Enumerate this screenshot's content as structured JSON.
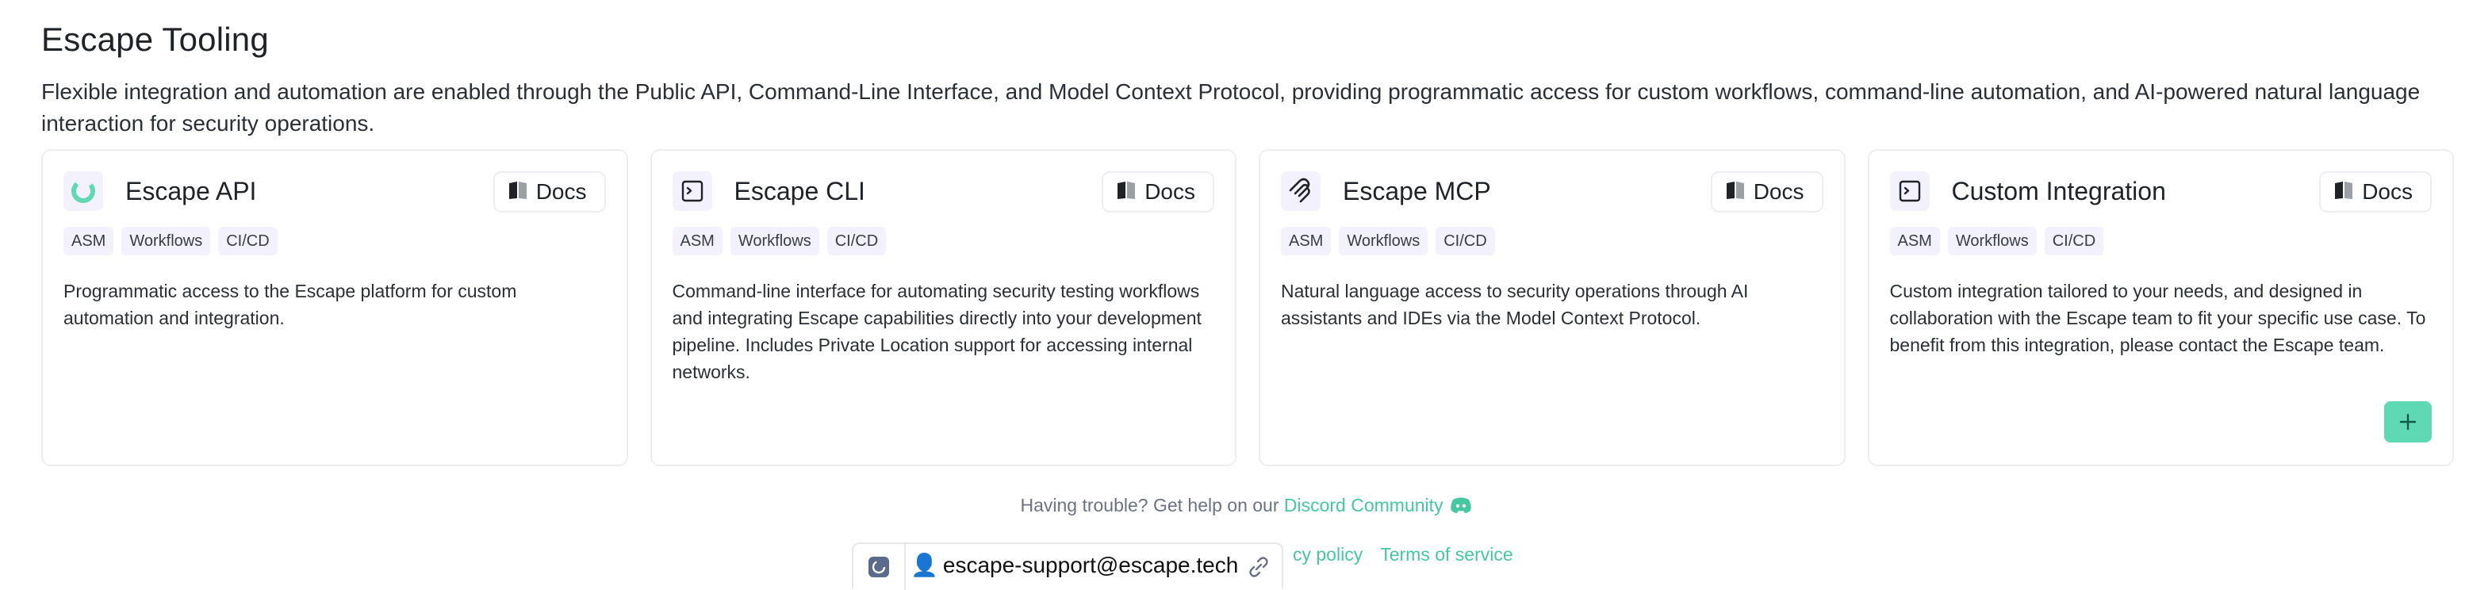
{
  "page": {
    "title": "Escape Tooling",
    "intro": "Flexible integration and automation are enabled through the Public API, Command-Line Interface, and Model Context Protocol, providing programmatic access for custom workflows, command-line automation, and AI-powered natural language interaction for security operations."
  },
  "cards": [
    {
      "title": "Escape API",
      "icon": "escape-logo-icon",
      "docs_label": "Docs",
      "tags": [
        "ASM",
        "Workflows",
        "CI/CD"
      ],
      "description": "Programmatic access to the Escape platform for custom automation and integration."
    },
    {
      "title": "Escape CLI",
      "icon": "terminal-icon",
      "docs_label": "Docs",
      "tags": [
        "ASM",
        "Workflows",
        "CI/CD"
      ],
      "description": "Command-line interface for automating security testing workflows and integrating Escape capabilities directly into your development pipeline. Includes Private Location support for accessing internal networks."
    },
    {
      "title": "Escape MCP",
      "icon": "mcp-icon",
      "docs_label": "Docs",
      "tags": [
        "ASM",
        "Workflows",
        "CI/CD"
      ],
      "description": "Natural language access to security operations through AI assistants and IDEs via the Model Context Protocol."
    },
    {
      "title": "Custom Integration",
      "icon": "terminal-icon",
      "docs_label": "Docs",
      "tags": [
        "ASM",
        "Workflows",
        "CI/CD"
      ],
      "description": "Custom integration tailored to your needs, and designed in collaboration with the Escape team to fit your specific use case. To benefit from this integration, please contact the Escape team.",
      "add_button": "+"
    }
  ],
  "footer": {
    "help_text": "Having trouble? Get help on our ",
    "discord_link": "Discord Community",
    "privacy_partial": "cy policy",
    "terms": "Terms of service"
  },
  "support_bar": {
    "email": "escape-support@escape.tech",
    "user_icon": "👤"
  },
  "colors": {
    "accent": "#45c7a0",
    "accent_button": "#5fd8b4",
    "border": "#eceef1",
    "tag_bg": "#f3f1fb"
  }
}
